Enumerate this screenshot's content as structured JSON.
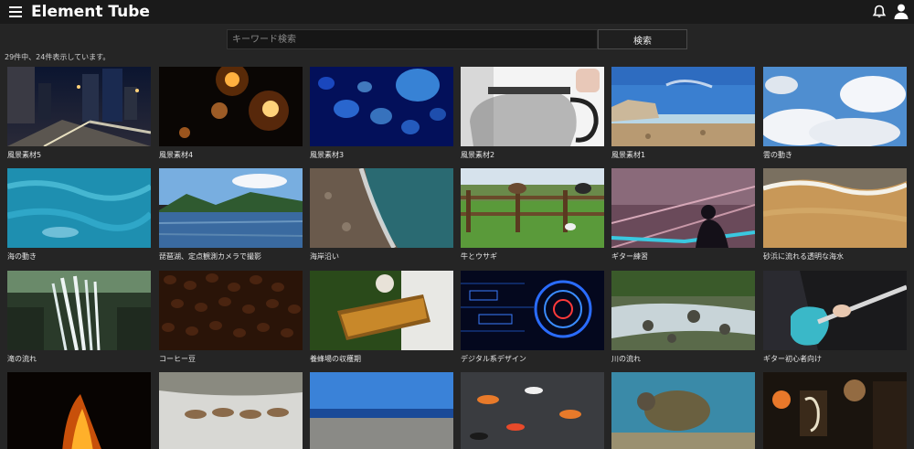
{
  "header": {
    "brand": "Element Tube",
    "menu_icon": "hamburger-menu-icon",
    "notification_icon": "bell-icon",
    "account_icon": "user-icon"
  },
  "search": {
    "placeholder": "キーワード検索",
    "button_label": "検索"
  },
  "results": {
    "summary": "29件中、24件表示しています。"
  },
  "videos": [
    {
      "title": "風景素材5"
    },
    {
      "title": "風景素材4"
    },
    {
      "title": "風景素材3"
    },
    {
      "title": "風景素材2"
    },
    {
      "title": "風景素材1"
    },
    {
      "title": "雲の動き"
    },
    {
      "title": "海の動き"
    },
    {
      "title": "琵琶湖、定点観測カメラで撮影"
    },
    {
      "title": "海岸沿い"
    },
    {
      "title": "牛とウサギ"
    },
    {
      "title": "ギター練習"
    },
    {
      "title": "砂浜に流れる透明な海水"
    },
    {
      "title": "滝の流れ"
    },
    {
      "title": "コーヒー豆"
    },
    {
      "title": "養蜂場の収穫期"
    },
    {
      "title": "デジタル系デザイン"
    },
    {
      "title": "川の流れ"
    },
    {
      "title": "ギター初心者向け"
    },
    {
      "title": ""
    },
    {
      "title": ""
    },
    {
      "title": ""
    },
    {
      "title": ""
    },
    {
      "title": ""
    },
    {
      "title": ""
    }
  ]
}
